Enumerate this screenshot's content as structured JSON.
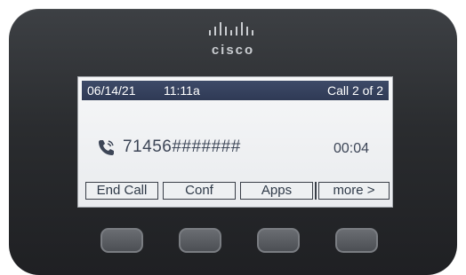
{
  "brand": {
    "name": "cisco"
  },
  "status": {
    "date": "06/14/21",
    "time": "11:11a",
    "call_index": "Call 2 of 2"
  },
  "call": {
    "icon": "phone-handset-icon",
    "number": "71456#######",
    "duration": "00:04"
  },
  "softkeys": [
    {
      "label": "End Call"
    },
    {
      "label": "Conf"
    },
    {
      "label": "Apps"
    },
    {
      "label": "more >"
    }
  ],
  "colors": {
    "statusbar_bg": "#334062",
    "screen_bg": "#eef0f2",
    "body_bg": "#2b2d30"
  }
}
